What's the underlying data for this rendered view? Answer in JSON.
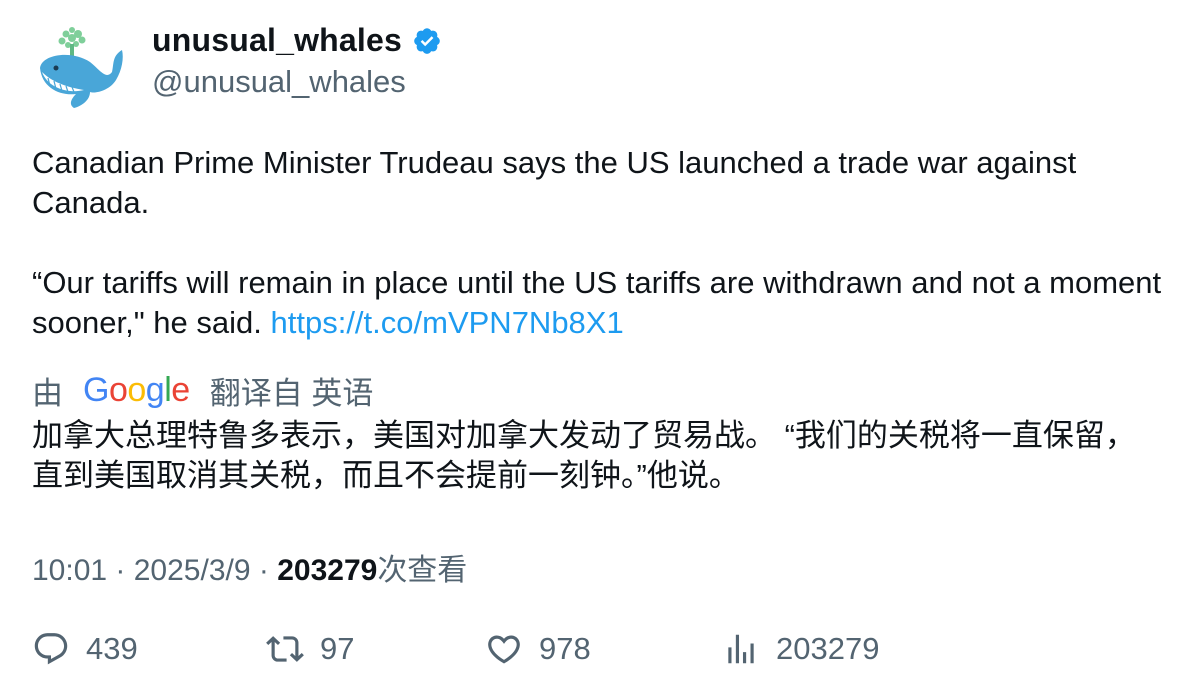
{
  "author": {
    "display_name": "unusual_whales",
    "handle": "@unusual_whales",
    "verified_icon": "verified-badge-icon",
    "avatar_icon": "whale-avatar-icon"
  },
  "tweet": {
    "text": "Canadian Prime Minister Trudeau says the US launched a trade war against Canada.\n\n“Our tariffs will remain in place until the US tariffs are withdrawn and not a moment sooner,\" he said. ",
    "link": "https://t.co/mVPN7Nb8X1"
  },
  "translation": {
    "prefix": "由",
    "provider": "Google",
    "suffix": "翻译自 英语",
    "text": "加拿大总理特鲁多表示，美国对加拿大发动了贸易战。 “我们的关税将一直保留，直到美国取消其关税，而且不会提前一刻钟。”他说。"
  },
  "meta": {
    "time": "10:01",
    "date": "2025/3/9",
    "views_count": "203279",
    "views_label": "次查看"
  },
  "actions": {
    "replies": "439",
    "retweets": "97",
    "likes": "978",
    "views": "203279"
  },
  "colors": {
    "link": "#1d9bf0",
    "secondary_text": "#536471",
    "verified": "#1d9bf0"
  }
}
